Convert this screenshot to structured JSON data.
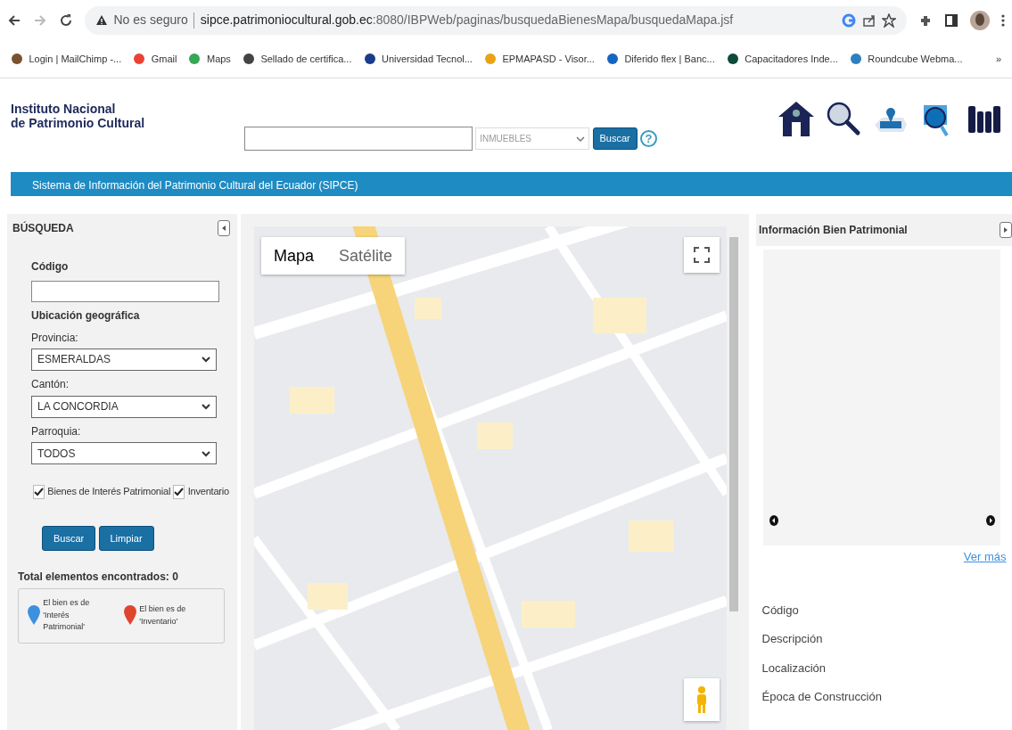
{
  "browser": {
    "security": "No es seguro",
    "url_host": "sipce.patrimoniocultural.gob.ec",
    "url_path": ":8080/IBPWeb/paginas/busquedaBienesMapa/busquedaMapa.jsf",
    "bookmarks": [
      {
        "label": "Login | MailChimp -...",
        "color": "#7a5230"
      },
      {
        "label": "Gmail",
        "color": "#ea4335"
      },
      {
        "label": "Maps",
        "color": "#34a853"
      },
      {
        "label": "Sellado de certifica...",
        "color": "#444444"
      },
      {
        "label": "Universidad Tecnol...",
        "color": "#1a3c8c"
      },
      {
        "label": "EPMAPASD - Visor...",
        "color": "#e8a317"
      },
      {
        "label": "Diferido flex | Banc...",
        "color": "#1565c0"
      },
      {
        "label": "Capacitadores Inde...",
        "color": "#0d4a3a"
      },
      {
        "label": "Roundcube Webma...",
        "color": "#2d7fc1"
      }
    ],
    "overflow": "»"
  },
  "header": {
    "logo_lines": [
      "Instituto Nacional",
      "de Patrimonio Cultural"
    ],
    "search_category": "INMUEBLES",
    "search_button": "Buscar",
    "help": "?"
  },
  "banner": "Sistema de Información del Patrimonio Cultural del Ecuador (SIPCE)",
  "search_panel": {
    "title": "BÚSQUEDA",
    "code_label": "Código",
    "location_heading": "Ubicación geográfica",
    "selects": [
      {
        "label": "Provincia:",
        "value": "ESMERALDAS"
      },
      {
        "label": "Cantón:",
        "value": "LA CONCORDIA"
      },
      {
        "label": "Parroquia:",
        "value": "TODOS"
      }
    ],
    "checkboxes": [
      {
        "label": "Bienes de Interés Patrimonial",
        "checked": true
      },
      {
        "label": "Inventario",
        "checked": true
      }
    ],
    "buttons": [
      "Buscar",
      "Limpiar"
    ],
    "total": "Total elementos encontrados: 0",
    "legend": [
      {
        "label": "El bien es de 'Interés Patrimonial'",
        "color": "#3d8fe0"
      },
      {
        "label": "El bien es de 'Inventario'",
        "color": "#e0432e"
      }
    ]
  },
  "map": {
    "tabs": [
      {
        "label": "Mapa",
        "selected": true
      },
      {
        "label": "Satélite",
        "selected": false
      }
    ]
  },
  "info_panel": {
    "title": "Información Bien Patrimonial",
    "more_link": "Ver más",
    "fields": [
      "Código",
      "Descripción",
      "Localización",
      "Época de Construcción"
    ]
  }
}
